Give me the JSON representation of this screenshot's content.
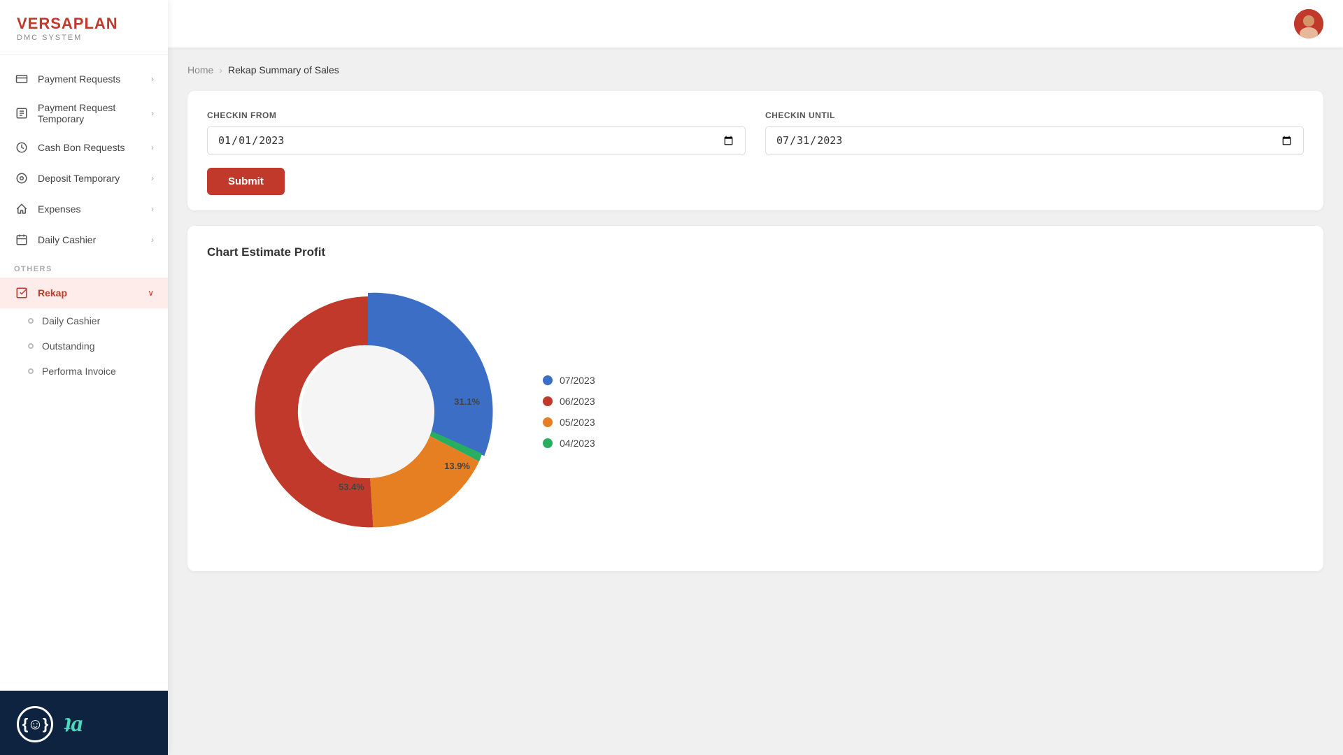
{
  "app": {
    "name": "VERSAPLAN",
    "sub": "DMC SYSTEM"
  },
  "sidebar": {
    "nav_items": [
      {
        "id": "payment-requests",
        "label": "Payment Requests",
        "icon": "💳",
        "has_arrow": true
      },
      {
        "id": "payment-request-temporary",
        "label": "Payment Request Temporary",
        "icon": "🗂️",
        "has_arrow": true
      },
      {
        "id": "cash-bon-requests",
        "label": "Cash Bon Requests",
        "icon": "💰",
        "has_arrow": true
      },
      {
        "id": "deposit-temporary",
        "label": "Deposit Temporary",
        "icon": "📷",
        "has_arrow": true
      },
      {
        "id": "expenses",
        "label": "Expenses",
        "icon": "↩️",
        "has_arrow": true
      },
      {
        "id": "daily-cashier",
        "label": "Daily Cashier",
        "icon": "📅",
        "has_arrow": true
      }
    ],
    "section_others": "OTHERS",
    "rekap_label": "Rekap",
    "sub_items": [
      {
        "id": "daily-cashier-sub",
        "label": "Daily Cashier"
      },
      {
        "id": "outstanding",
        "label": "Outstanding"
      },
      {
        "id": "performa-invoice",
        "label": "Performa Invoice"
      }
    ]
  },
  "topbar": {
    "avatar_emoji": "👩"
  },
  "breadcrumb": {
    "home": "Home",
    "separator": "›",
    "current": "Rekap Summary of Sales"
  },
  "filter": {
    "checkin_from_label": "CHECKIN FROM",
    "checkin_from_value": "01/01/2023",
    "checkin_until_label": "CHECKIN UNTIL",
    "checkin_until_value": "07/31/2023",
    "submit_label": "Submit"
  },
  "chart": {
    "title": "Chart Estimate Profit",
    "segments": [
      {
        "id": "jul2023",
        "label": "07/2023",
        "color": "#3b6ec4",
        "percent": 31.1,
        "startAngle": -90,
        "endAngle": 22
      },
      {
        "id": "apr2023",
        "label": "04/2023",
        "color": "#2ecc71",
        "percent": 1.6,
        "startAngle": 22,
        "endAngle": 28
      },
      {
        "id": "may2023",
        "label": "05/2023",
        "color": "#e67e22",
        "percent": 13.9,
        "startAngle": 28,
        "endAngle": 78
      },
      {
        "id": "jun2023",
        "label": "06/2023",
        "color": "#c0392b",
        "percent": 53.4,
        "startAngle": 78,
        "endAngle": 270
      }
    ],
    "legend": [
      {
        "label": "07/2023",
        "color": "#3b6ec4"
      },
      {
        "label": "06/2023",
        "color": "#c0392b"
      },
      {
        "label": "05/2023",
        "color": "#e67e22"
      },
      {
        "label": "04/2023",
        "color": "#2ecc71"
      }
    ],
    "label_53": "53.4%",
    "label_31": "31.1%",
    "label_14": "13.9%"
  }
}
